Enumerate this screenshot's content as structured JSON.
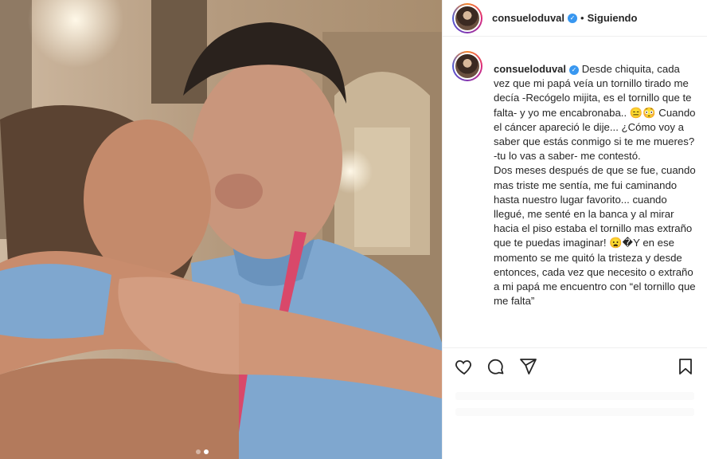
{
  "post": {
    "username": "consueloduval",
    "verified_glyph": "✓",
    "separator": "•",
    "follow_state": "Siguiendo"
  },
  "caption": {
    "username": "consueloduval",
    "text": " Desde chiquita, cada vez que mi papá veía un tornillo tirado me decía -Recógelo mijita, es el tornillo que te falta- y yo me encabronaba.. 😑😳 Cuando el cáncer apareció le dije... ¿Cómo voy a saber que estás conmigo si te me mueres? -tu lo vas a saber- me contestó.\nDos meses después de que se fue, cuando mas triste me sentía, me fui caminando hasta nuestro lugar favorito... cuando llegué, me senté en la banca y al mirar hacia el piso estaba el tornillo mas extraño que te puedas imaginar! 😦�Y en ese momento se me quitó la tristeza y desde entonces, cada vez que necesito o extraño a mi papá me encuentro con “el tornillo que me falta”"
  },
  "actions": {
    "like_icon": "heart-icon",
    "comment_icon": "comment-icon",
    "share_icon": "share-icon",
    "save_icon": "bookmark-icon"
  },
  "carousel": {
    "count": 2,
    "active_index": 1
  },
  "colors": {
    "verified": "#3897f0",
    "text": "#262626",
    "border": "#efefef"
  }
}
